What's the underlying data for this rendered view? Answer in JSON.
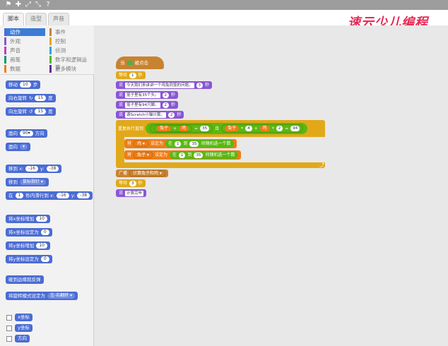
{
  "menubar": {
    "icons": [
      "person-stamp-icon",
      "duplicate-icon",
      "grow-icon",
      "shrink-icon",
      "help-icon"
    ],
    "glyphs": [
      "⚑",
      "✚",
      "⤢",
      "⤡",
      "?"
    ]
  },
  "tabs": [
    "脚本",
    "造型",
    "声音"
  ],
  "logo": "速云少儿编程",
  "categories": {
    "left": [
      "动作",
      "外观",
      "声音",
      "画笔",
      "数据"
    ],
    "right": [
      "事件",
      "控制",
      "侦测",
      "数字和逻辑运算",
      "更多模块"
    ]
  },
  "palette_blocks": {
    "move": {
      "label": "移动",
      "value": "10",
      "unit": "步"
    },
    "turn_right": {
      "label": "向右旋转",
      "value": "15",
      "unit": "度"
    },
    "turn_left": {
      "label": "向左旋转",
      "value": "15",
      "unit": "度"
    },
    "point_dir": {
      "label": "面向",
      "value": "90▾",
      "unit": "方向"
    },
    "point_towards": {
      "label": "面向",
      "value": "▾"
    },
    "goto_xy": {
      "label": "移到 x:",
      "x": "-16",
      "ylabel": "y:",
      "y": "-38"
    },
    "goto": {
      "label": "移到",
      "value": "鼠标指针 ▾"
    },
    "glide": {
      "label": "在",
      "secs": "1",
      "mid": "秒内滑行到 x:",
      "x": "-16",
      "ylabel": "y:",
      "y": "-38"
    },
    "change_x": {
      "label": "将x坐标增加",
      "value": "10"
    },
    "set_x": {
      "label": "将x坐标设定为",
      "value": "0"
    },
    "change_y": {
      "label": "将y坐标增加",
      "value": "10"
    },
    "set_y": {
      "label": "将y坐标设定为",
      "value": "0"
    },
    "bounce": {
      "label": "碰到边缘就反弹"
    },
    "rotation": {
      "label": "将旋转模式设定为",
      "value": "左-右翻转 ▾"
    },
    "reporters": [
      "x坐标",
      "y坐标",
      "方向"
    ]
  },
  "script": {
    "hat": {
      "label": "当",
      "after": "被点击"
    },
    "wait1": {
      "label": "等待",
      "value": "1",
      "unit": "秒"
    },
    "say1": {
      "label": "说",
      "text": "今天我们来讲讲一个鸡兔同笼的问题。",
      "value": "3",
      "unit": "秒"
    },
    "say2": {
      "label": "说",
      "text": "笼子里有35个头。",
      "value": "2",
      "unit": "秒"
    },
    "say3": {
      "label": "说",
      "text": "笼子里有94只脚。",
      "value": "2",
      "unit": "秒"
    },
    "say4": {
      "label": "说",
      "text": "请Scratch小猫计算。",
      "value": "2",
      "unit": "秒"
    },
    "repeat_until": {
      "label": "重复执行直到",
      "a": "兔子",
      "plus1": "+",
      "b": "鸡",
      "eq1": "=",
      "v1": "35",
      "and": "且",
      "c": "兔子",
      "times1": "*",
      "v2": "4",
      "plus2": "+",
      "d": "鸡",
      "times2": "*",
      "v3": "2",
      "eq2": "=",
      "v4": "94"
    },
    "set1": {
      "label": "将",
      "var": "鸡 ▾",
      "mid": "设定为",
      "pick": "在",
      "from": "1",
      "to_label": "到",
      "to": "35",
      "end": "间随机选一个数"
    },
    "set2": {
      "label": "将",
      "var": "兔子 ▾",
      "mid": "设定为",
      "pick": "在",
      "from": "1",
      "to_label": "到",
      "to": "35",
      "end": "间随机选一个数"
    },
    "broadcast": {
      "label": "广播",
      "value": "计算兔子和鸡 ▾"
    },
    "wait2": {
      "label": "等待",
      "value": "3",
      "unit": "秒"
    },
    "say5": {
      "label": "说",
      "text": "计算完毕"
    }
  }
}
